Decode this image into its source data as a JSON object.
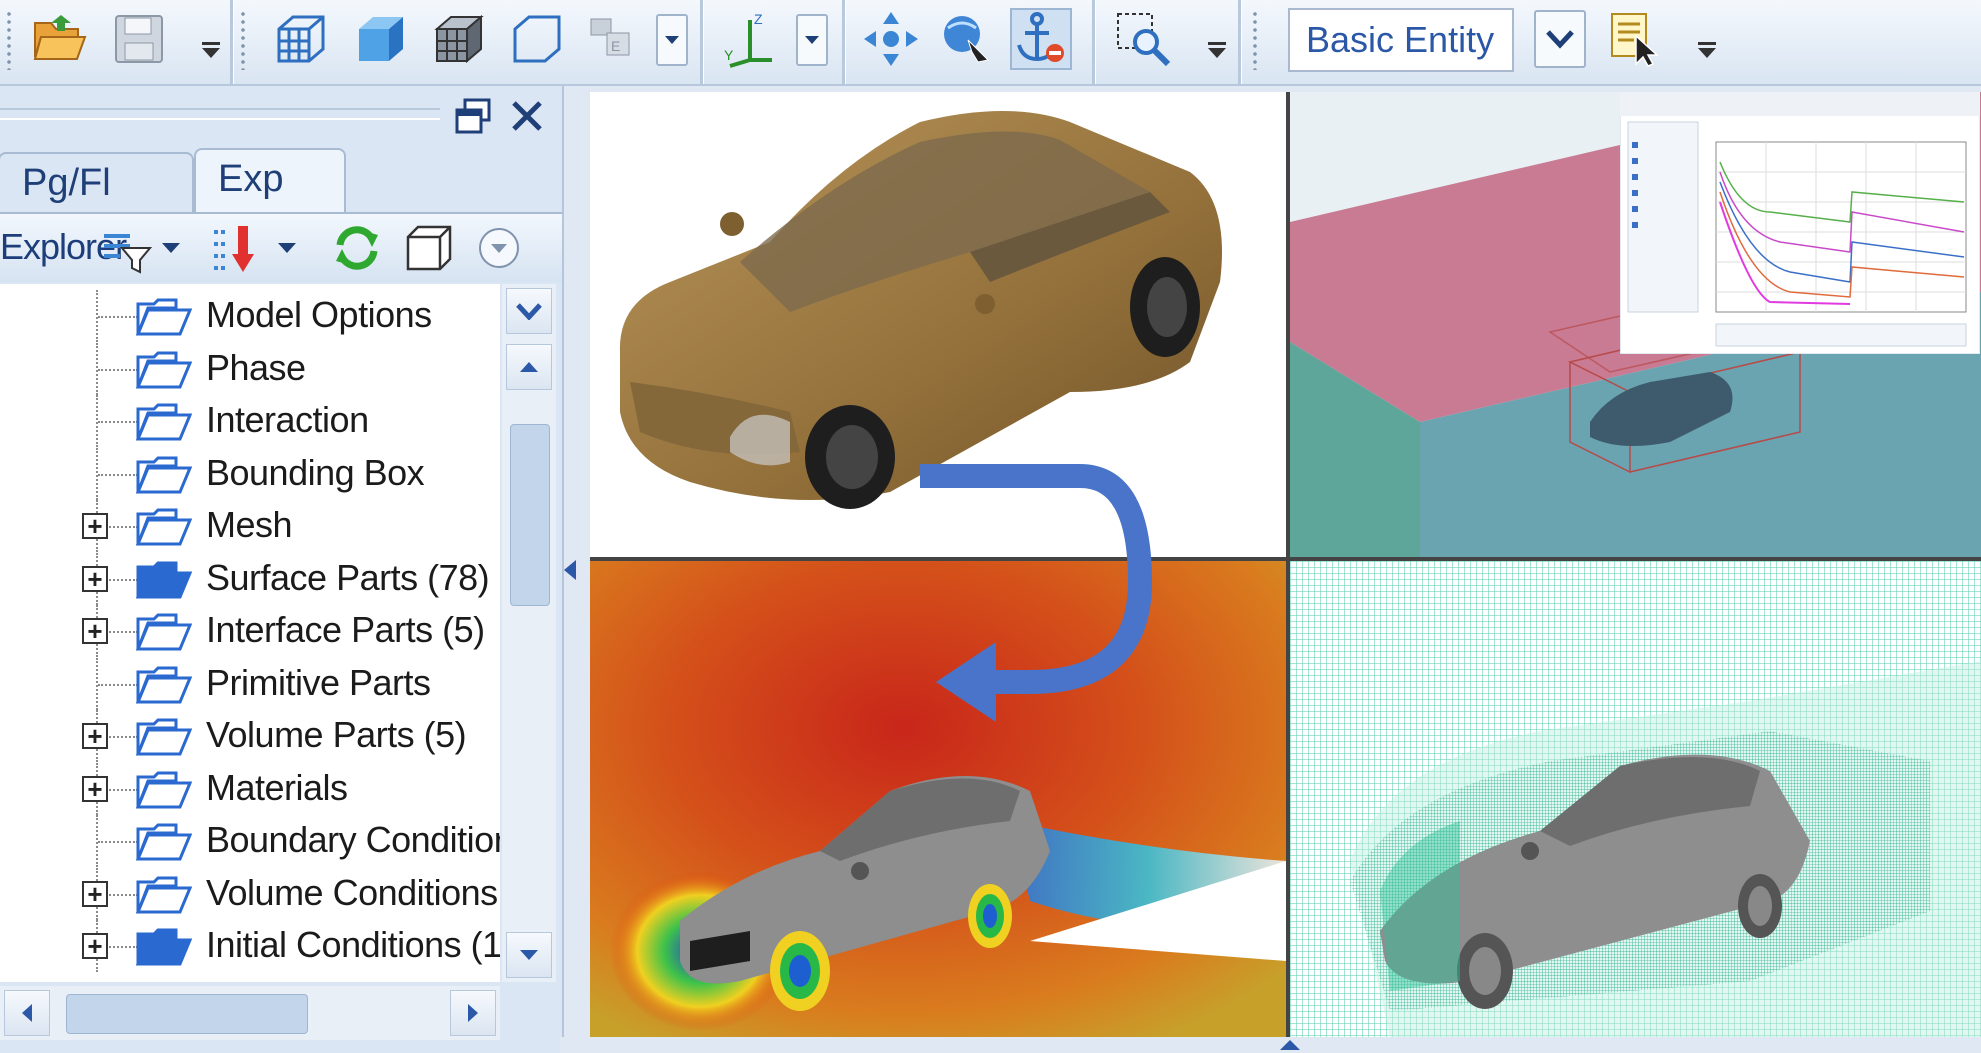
{
  "toolbar": {
    "entity_select_value": "Basic Entity",
    "icons": [
      "open-folder-icon",
      "save-icon",
      "wireframe-box-icon",
      "solid-box-icon",
      "hidden-line-box-icon",
      "outline-box-icon",
      "view-mode-icon",
      "axis-orientation-icon",
      "pan-icon",
      "rotate-icon",
      "anchor-icon",
      "zoom-box-icon",
      "select-entity-icon"
    ]
  },
  "panel": {
    "tabs": [
      "Pg/Fl",
      "Exp"
    ],
    "active_tab": "Exp",
    "explorer_label": "Explorer"
  },
  "tree": {
    "items": [
      {
        "label": "Model Options",
        "expandable": false,
        "filled": false
      },
      {
        "label": "Phase",
        "expandable": false,
        "filled": false
      },
      {
        "label": "Interaction",
        "expandable": false,
        "filled": false
      },
      {
        "label": "Bounding Box",
        "expandable": false,
        "filled": false
      },
      {
        "label": "Mesh",
        "expandable": true,
        "filled": false
      },
      {
        "label": "Surface Parts (78)",
        "expandable": true,
        "filled": true
      },
      {
        "label": "Interface Parts (5)",
        "expandable": true,
        "filled": false
      },
      {
        "label": "Primitive Parts",
        "expandable": false,
        "filled": false
      },
      {
        "label": "Volume Parts (5)",
        "expandable": true,
        "filled": false
      },
      {
        "label": "Materials",
        "expandable": true,
        "filled": false
      },
      {
        "label": "Boundary Conditior",
        "expandable": false,
        "filled": false
      },
      {
        "label": "Volume Conditions",
        "expandable": true,
        "filled": false
      },
      {
        "label": "Initial Conditions (1",
        "expandable": true,
        "filled": true
      }
    ]
  },
  "colors": {
    "accent": "#2c58a8",
    "car_body": "#9c7a3c",
    "mesh": "#2fc29a",
    "domain_top": "#c97b93",
    "flow_arrow": "#4a74c9"
  }
}
